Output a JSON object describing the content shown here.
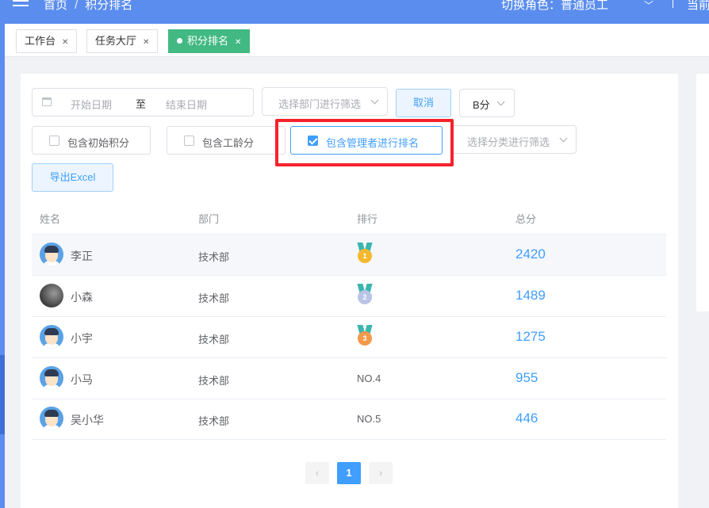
{
  "header": {
    "breadcrumb": [
      "首页",
      "积分排名"
    ],
    "role_label": "切换角色：",
    "role_value": "普通员工",
    "current_label": "当前"
  },
  "tabs": [
    {
      "label": "工作台",
      "active": false
    },
    {
      "label": "任务大厅",
      "active": false
    },
    {
      "label": "积分排名",
      "active": true
    }
  ],
  "filters": {
    "start_date_placeholder": "开始日期",
    "range_separator": "至",
    "end_date_placeholder": "结束日期",
    "department_placeholder": "选择部门进行筛选",
    "cancel_label": "取消",
    "score_type_value": "B分",
    "include_initial_label": "包含初始积分",
    "include_initial_checked": false,
    "include_seniority_label": "包含工龄分",
    "include_seniority_checked": false,
    "include_managers_label": "包含管理者进行排名",
    "include_managers_checked": true,
    "category_placeholder": "选择分类进行筛选",
    "export_label": "导出Excel"
  },
  "table": {
    "columns": [
      "姓名",
      "部门",
      "排行",
      "总分"
    ],
    "rows": [
      {
        "name": "李正",
        "department": "技术部",
        "rank": "1",
        "medal": "gold",
        "score": "2420",
        "avatar": "cartoon-avatar"
      },
      {
        "name": "小森",
        "department": "技术部",
        "rank": "2",
        "medal": "silver",
        "score": "1489",
        "avatar": "photo-avatar"
      },
      {
        "name": "小宇",
        "department": "技术部",
        "rank": "3",
        "medal": "bronze",
        "score": "1275",
        "avatar": "cartoon-avatar"
      },
      {
        "name": "小马",
        "department": "技术部",
        "rank": "NO.4",
        "medal": "",
        "score": "955",
        "avatar": "cartoon-avatar"
      },
      {
        "name": "吴小华",
        "department": "技术部",
        "rank": "NO.5",
        "medal": "",
        "score": "446",
        "avatar": "cartoon-avatar"
      }
    ]
  },
  "pagination": {
    "prev_icon": "‹",
    "current_page": "1",
    "next_icon": "›"
  },
  "colors": {
    "header": "#5b8def",
    "active_tab": "#42b983",
    "primary": "#409eff",
    "highlight_box": "#f5222d"
  }
}
